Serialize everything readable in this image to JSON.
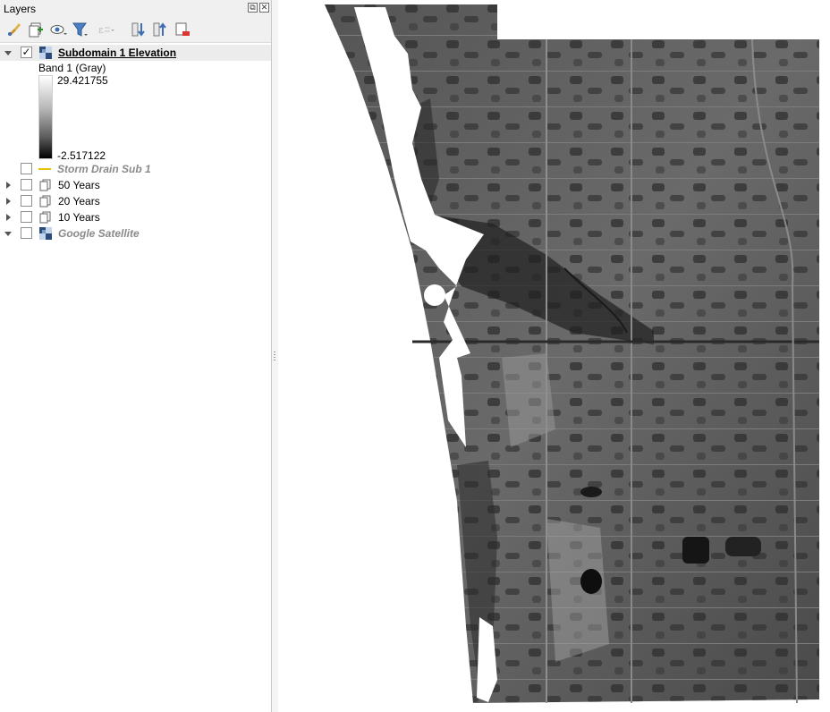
{
  "dock": {
    "title": "Layers",
    "float_button": "⧉",
    "close_button": "✕"
  },
  "toolbar": {
    "buttons": [
      "style-manager",
      "add-group",
      "manage-visibility",
      "filter-legend",
      "filter-by-expression",
      "expand-all",
      "collapse-all",
      "remove-layer"
    ]
  },
  "layers": [
    {
      "name": "Subdomain 1 Elevation",
      "checked": true,
      "expanded": true,
      "icon": "raster-icon"
    },
    {
      "name": "Storm Drain Sub 1",
      "checked": false,
      "icon": "line-symbol-icon"
    },
    {
      "name": "50 Years",
      "checked": false,
      "icon": "layer-group-icon"
    },
    {
      "name": "20 Years",
      "checked": false,
      "icon": "layer-group-icon"
    },
    {
      "name": "10 Years",
      "checked": false,
      "icon": "layer-group-icon"
    },
    {
      "name": "Google Satellite",
      "checked": false,
      "expanded": true,
      "icon": "raster-icon"
    }
  ],
  "legend": {
    "band_label": "Band 1 (Gray)",
    "max_value": "29.421755",
    "min_value": "-2.517122"
  },
  "colors": {
    "line_symbol": "#e6c200",
    "ramp_white": "#ffffff",
    "ramp_black": "#000000"
  }
}
